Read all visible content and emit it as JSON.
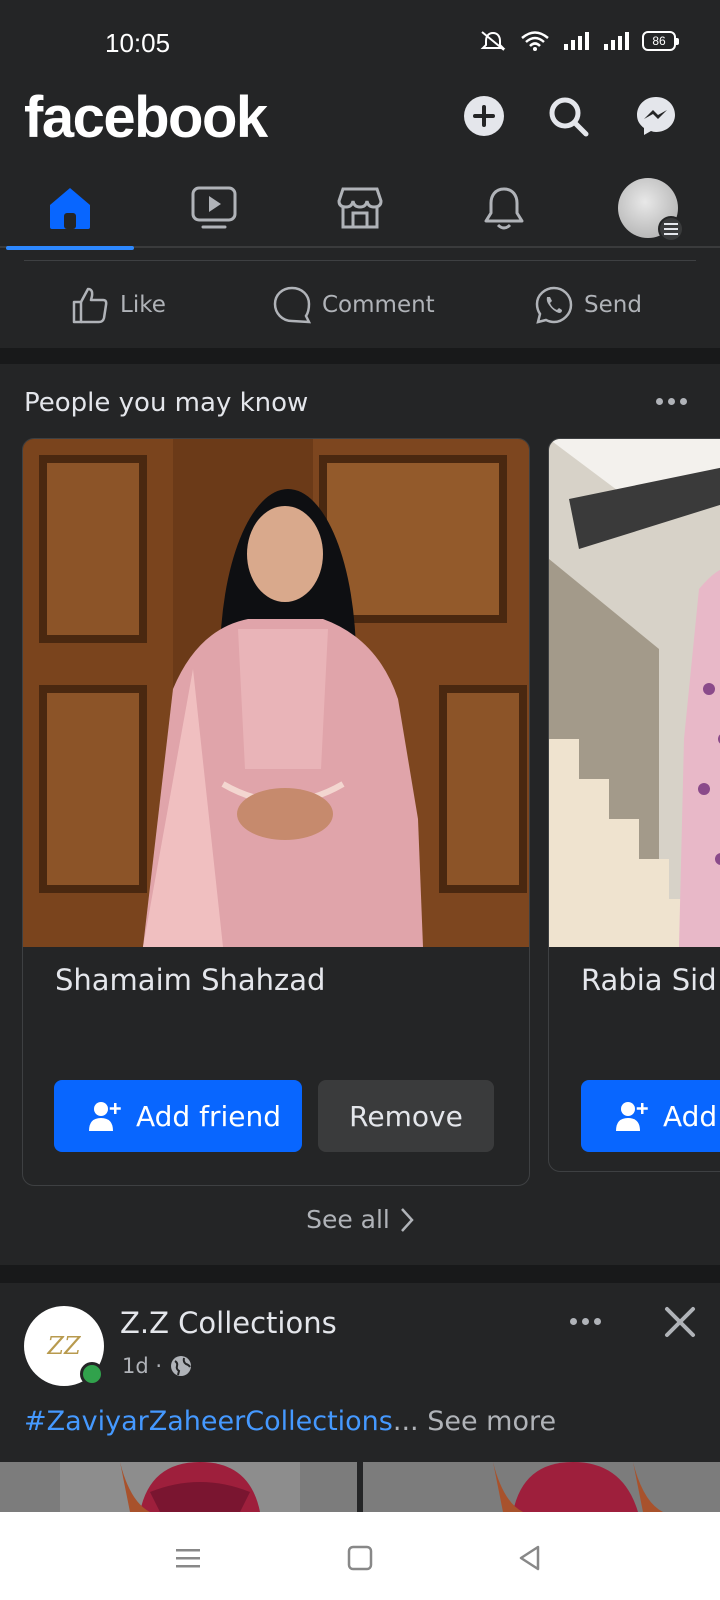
{
  "status_bar": {
    "time": "10:05",
    "battery": "86"
  },
  "header": {
    "logo": "facebook",
    "icons": [
      "add-icon",
      "search-icon",
      "messenger-icon"
    ]
  },
  "tabs": [
    {
      "icon": "home-icon",
      "active": true
    },
    {
      "icon": "video-icon",
      "active": false
    },
    {
      "icon": "marketplace-icon",
      "active": false
    },
    {
      "icon": "bell-icon",
      "active": false
    },
    {
      "icon": "profile-avatar",
      "active": false
    }
  ],
  "actions": {
    "like": "Like",
    "comment": "Comment",
    "send": "Send"
  },
  "pymk": {
    "title": "People you may know",
    "cards": [
      {
        "name": "Shamaim Shahzad",
        "add": "Add friend",
        "remove": "Remove"
      },
      {
        "name": "Rabia Sid",
        "add": "Add"
      }
    ],
    "see_all": "See all"
  },
  "post": {
    "page_name": "Z.Z Collections",
    "avatar_text": "ZZ",
    "time": "1d ·",
    "hashtag": "#ZaviyarZaheerCollections",
    "ellipsis": "...",
    "see_more": "See more"
  },
  "colors": {
    "accent": "#0866ff",
    "background": "#242526",
    "separator": "#18191a"
  }
}
